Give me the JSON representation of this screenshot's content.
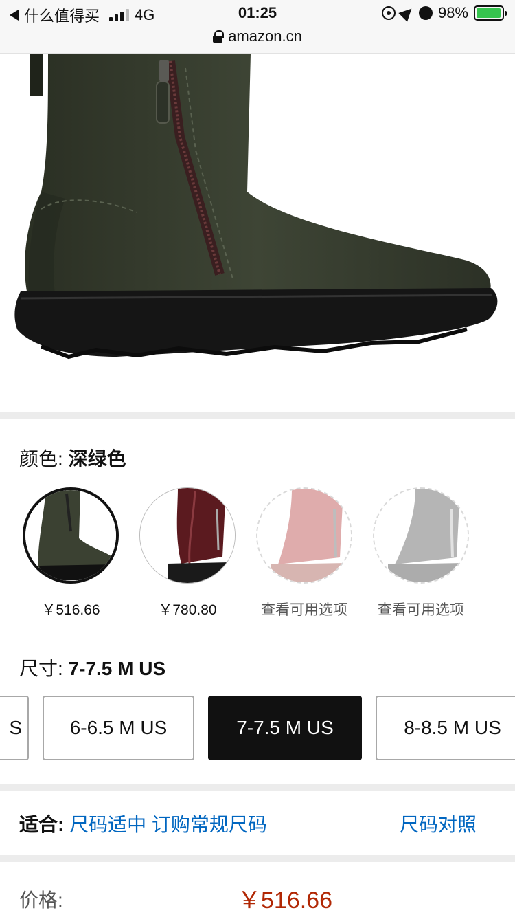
{
  "status_bar": {
    "back_app": "什么值得买",
    "network": "4G",
    "time": "01:25",
    "battery": "98%",
    "battery_level": 0.98,
    "url": "amazon.cn"
  },
  "color_section": {
    "label": "颜色: ",
    "selected_value": "深绿色",
    "swatches": [
      {
        "price": "￥516.66",
        "color": "#3b4132",
        "state": "selected"
      },
      {
        "price": "￥780.80",
        "color": "#5b1a1f",
        "state": "available"
      },
      {
        "price": "查看可用选项",
        "color": "#c56a6a",
        "state": "unavailable"
      },
      {
        "price": "查看可用选项",
        "color": "#7a7a7a",
        "state": "unavailable"
      }
    ]
  },
  "size_section": {
    "label": "尺寸: ",
    "selected_value": "7-7.5 M US",
    "options": [
      {
        "label": "S",
        "state": "available"
      },
      {
        "label": "6-6.5 M US",
        "state": "available"
      },
      {
        "label": "7-7.5 M US",
        "state": "selected"
      },
      {
        "label": "8-8.5 M US",
        "state": "available"
      }
    ]
  },
  "fit_section": {
    "label": "适合: ",
    "value": "尺码适中 订购常规尺码",
    "size_chart_link": "尺码对照"
  },
  "price_section": {
    "label": "价格:",
    "value": "￥516.66"
  },
  "colors": {
    "link": "#0066c0",
    "price": "#b12704",
    "selected_size_bg": "#111111"
  }
}
